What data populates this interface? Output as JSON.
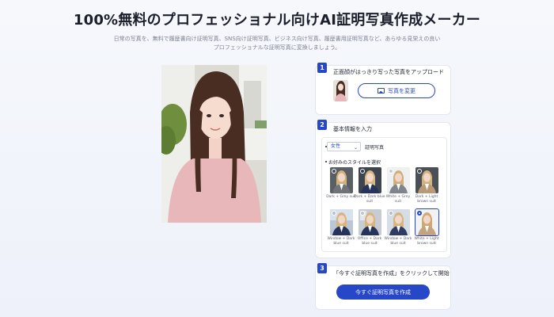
{
  "header": {
    "title": "100%無料のプロフェッショナル向けAI証明写真作成メーカー",
    "subtitle_line1": "日常の写真を、無料で履歴書向け証明写真、SNS向け証明写真、ビジネス向け写真、履歴書用証明写真など、あらゆる見栄えの良い",
    "subtitle_line2": "プロフェッショナルな証明写真に変換しましょう。"
  },
  "steps": [
    {
      "number": "1",
      "label": "正面顔がはっきり写った写真をアップロード",
      "button": "写真を変更"
    },
    {
      "number": "2",
      "label": "基本情報を入力",
      "gender_value": "女性",
      "gender_suffix": "証明写真",
      "style_heading": "お好みのスタイルを選択"
    },
    {
      "number": "3",
      "label": "「今すぐ証明写真を作成」をクリックして開始",
      "button": "今すぐ証明写真を作成"
    }
  ],
  "styles": [
    {
      "caption": "Dark + Grey suit",
      "selected": false
    },
    {
      "caption": "Dark + Dark blue suit",
      "selected": false
    },
    {
      "caption": "White + Grey suit",
      "selected": false
    },
    {
      "caption": "Dark + Light brown suit",
      "selected": false
    },
    {
      "caption": "Window + Dark blue suit",
      "selected": false
    },
    {
      "caption": "Office + Dark blue suit",
      "selected": false
    },
    {
      "caption": "Window + Dark blue suit",
      "selected": false
    },
    {
      "caption": "White + Light brown suit",
      "selected": true
    }
  ],
  "colors": {
    "accent": "#2747c9",
    "card_border": "#e3e6ef"
  }
}
